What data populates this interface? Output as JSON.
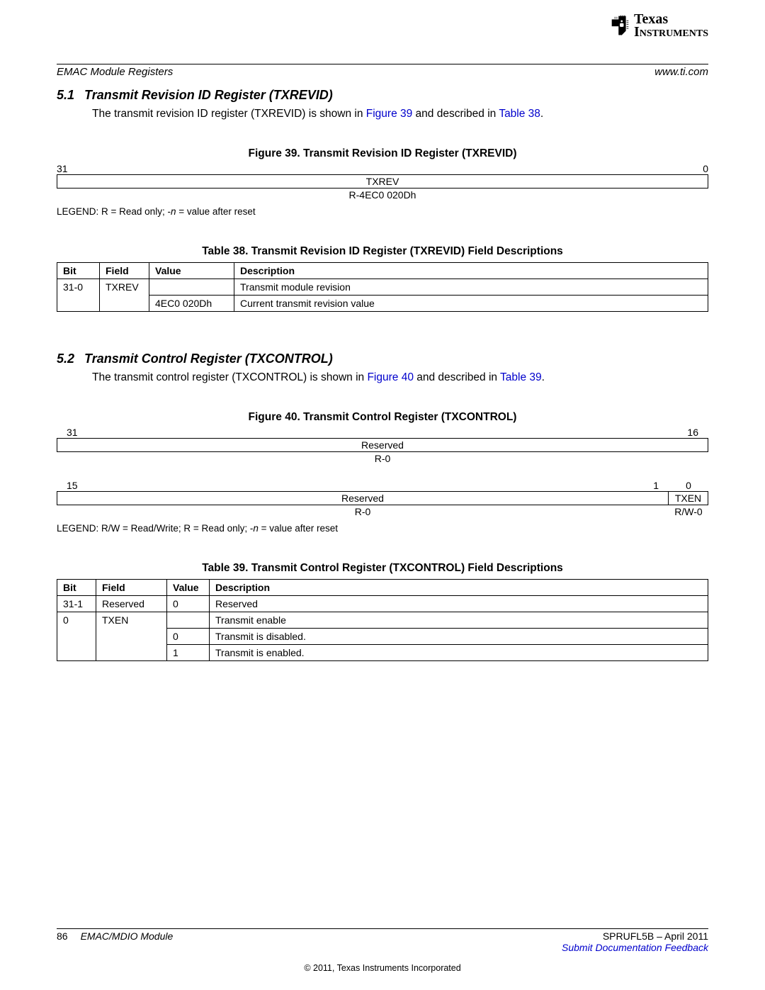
{
  "header": {
    "left": "EMAC Module Registers",
    "right": "www.ti.com",
    "logo_line1": "Texas",
    "logo_line2": "Instruments"
  },
  "section51": {
    "num": "5.1",
    "title": "Transmit Revision ID Register (TXREVID)",
    "body_pre": "The transmit revision ID register (TXREVID) is shown in ",
    "fig_link": "Figure 39",
    "body_mid": " and described in ",
    "tbl_link": "Table 38",
    "body_post": "."
  },
  "figure39": {
    "caption": "Figure 39. Transmit Revision ID Register (TXREVID)",
    "bit_hi": "31",
    "bit_lo": "0",
    "field": "TXREV",
    "access": "R-4EC0 020Dh",
    "legend_pre": "LEGEND: R = Read only; -",
    "legend_n": "n",
    "legend_post": " = value after reset"
  },
  "table38": {
    "caption": "Table 38. Transmit Revision ID Register (TXREVID) Field Descriptions",
    "headers": {
      "bit": "Bit",
      "field": "Field",
      "value": "Value",
      "desc": "Description"
    },
    "rows": [
      {
        "bit": "31-0",
        "field": "TXREV",
        "value": "",
        "desc": "Transmit module revision"
      },
      {
        "bit": "",
        "field": "",
        "value": "4EC0 020Dh",
        "desc": "Current transmit revision value"
      }
    ]
  },
  "section52": {
    "num": "5.2",
    "title": "Transmit Control Register (TXCONTROL)",
    "body_pre": "The transmit control register (TXCONTROL) is shown in ",
    "fig_link": "Figure 40",
    "body_mid": " and described in ",
    "tbl_link": "Table 39",
    "body_post": "."
  },
  "figure40": {
    "caption": "Figure 40. Transmit Control Register (TXCONTROL)",
    "row1": {
      "bit_hi": "31",
      "bit_lo": "16",
      "field": "Reserved",
      "access": "R-0"
    },
    "row2": {
      "bit_hi": "15",
      "bit_mid": "1",
      "bit_lo": "0",
      "field_wide": "Reserved",
      "field_narrow": "TXEN",
      "access_wide": "R-0",
      "access_narrow": "R/W-0"
    },
    "legend_pre": "LEGEND: R/W = Read/Write; R = Read only; -",
    "legend_n": "n",
    "legend_post": " = value after reset"
  },
  "table39": {
    "caption": "Table 39. Transmit Control Register (TXCONTROL) Field Descriptions",
    "headers": {
      "bit": "Bit",
      "field": "Field",
      "value": "Value",
      "desc": "Description"
    },
    "rows": [
      {
        "bit": "31-1",
        "field": "Reserved",
        "value": "0",
        "desc": "Reserved"
      },
      {
        "bit": "0",
        "field": "TXEN",
        "value": "",
        "desc": "Transmit enable"
      },
      {
        "bit": "",
        "field": "",
        "value": "0",
        "desc": "Transmit is disabled."
      },
      {
        "bit": "",
        "field": "",
        "value": "1",
        "desc": "Transmit is enabled."
      }
    ]
  },
  "footer": {
    "page": "86",
    "module": "EMAC/MDIO Module",
    "docid": "SPRUFL5B – April 2011",
    "feedback": "Submit Documentation Feedback",
    "copyright": "© 2011, Texas Instruments Incorporated"
  }
}
